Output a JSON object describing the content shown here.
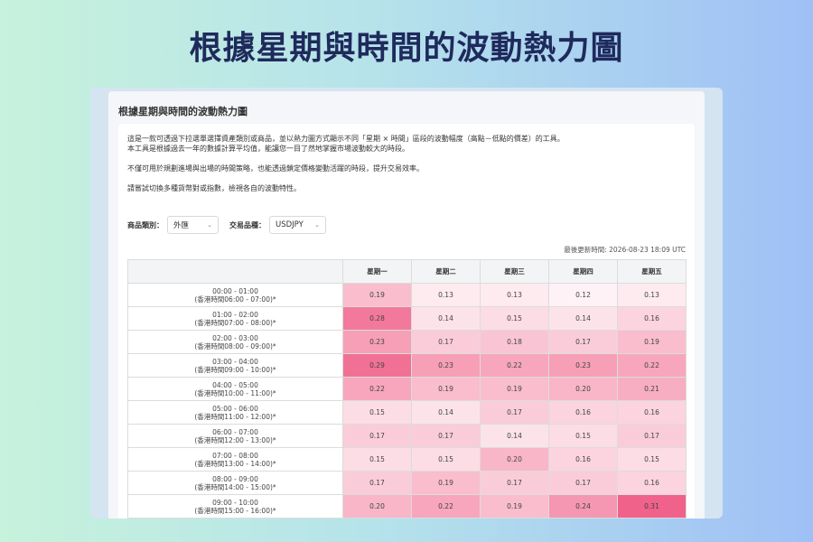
{
  "page": {
    "headline": "根據星期與時間的波動熱力圖"
  },
  "panel": {
    "title": "根據星期與時間的波動熱力圖",
    "description": [
      "這是一款可透過下拉選單選擇資產類別或商品，並以熱力圖方式顯示不同「星期 × 時間」區段的波動幅度（高點－低點的價差）的工具。",
      "本工具是根據過去一年的數據計算平均值，能讓您一目了然地掌握市場波動較大的時段。",
      "",
      "不僅可用於規劃進場與出場的時間策略，也能透過鎖定價格變動活躍的時段，提升交易效率。",
      "",
      "請嘗試切換多種貨幣對或指數，檢視各自的波動特性。"
    ]
  },
  "filters": {
    "category_label": "商品類別：",
    "category_value": "外匯",
    "instrument_label": "交易品種：",
    "instrument_value": "USDJPY"
  },
  "updated": "最後更新時間: 2026-08-23 18:09 UTC",
  "colors": {
    "scale_min": "#ffffff",
    "scale_max": "#f0628a"
  },
  "table": {
    "corner": "",
    "days": [
      "星期一",
      "星期二",
      "星期三",
      "星期四",
      "星期五"
    ],
    "rows": [
      {
        "time": "00:00 - 01:00",
        "hk": "(香港時間06:00 - 07:00)*",
        "values": [
          "0.19",
          "0.13",
          "0.13",
          "0.12",
          "0.13"
        ]
      },
      {
        "time": "01:00 - 02:00",
        "hk": "(香港時間07:00 - 08:00)*",
        "values": [
          "0.28",
          "0.14",
          "0.15",
          "0.14",
          "0.16"
        ]
      },
      {
        "time": "02:00 - 03:00",
        "hk": "(香港時間08:00 - 09:00)*",
        "values": [
          "0.23",
          "0.17",
          "0.18",
          "0.17",
          "0.19"
        ]
      },
      {
        "time": "03:00 - 04:00",
        "hk": "(香港時間09:00 - 10:00)*",
        "values": [
          "0.29",
          "0.23",
          "0.22",
          "0.23",
          "0.22"
        ]
      },
      {
        "time": "04:00 - 05:00",
        "hk": "(香港時間10:00 - 11:00)*",
        "values": [
          "0.22",
          "0.19",
          "0.19",
          "0.20",
          "0.21"
        ]
      },
      {
        "time": "05:00 - 06:00",
        "hk": "(香港時間11:00 - 12:00)*",
        "values": [
          "0.15",
          "0.14",
          "0.17",
          "0.16",
          "0.16"
        ]
      },
      {
        "time": "06:00 - 07:00",
        "hk": "(香港時間12:00 - 13:00)*",
        "values": [
          "0.17",
          "0.17",
          "0.14",
          "0.15",
          "0.17"
        ]
      },
      {
        "time": "07:00 - 08:00",
        "hk": "(香港時間13:00 - 14:00)*",
        "values": [
          "0.15",
          "0.15",
          "0.20",
          "0.16",
          "0.15"
        ]
      },
      {
        "time": "08:00 - 09:00",
        "hk": "(香港時間14:00 - 15:00)*",
        "values": [
          "0.17",
          "0.19",
          "0.17",
          "0.17",
          "0.16"
        ]
      },
      {
        "time": "09:00 - 10:00",
        "hk": "(香港時間15:00 - 16:00)*",
        "values": [
          "0.20",
          "0.22",
          "0.19",
          "0.24",
          "0.31"
        ]
      }
    ]
  }
}
